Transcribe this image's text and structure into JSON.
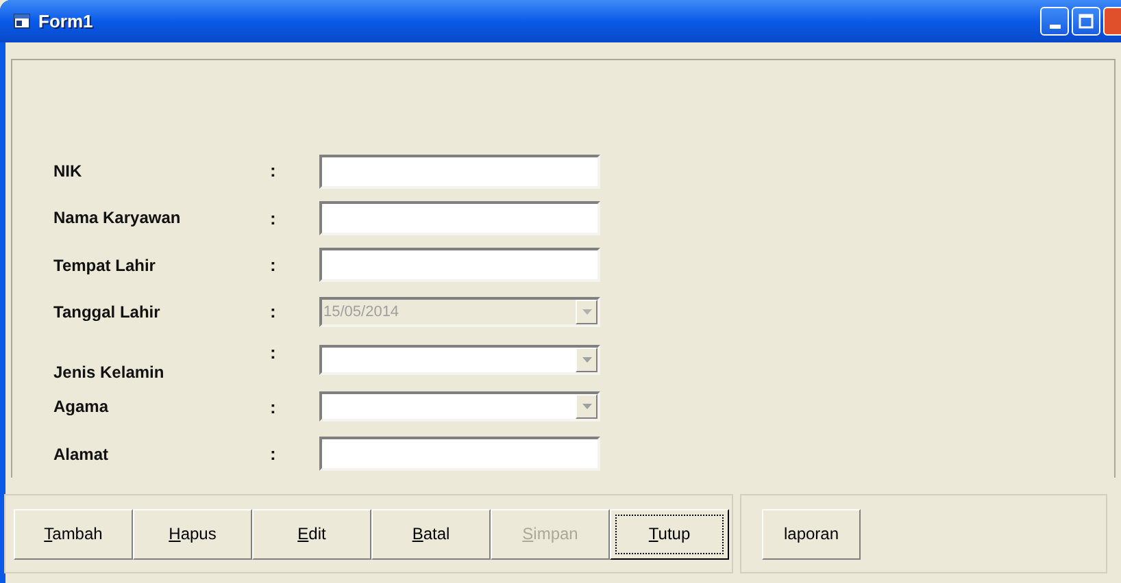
{
  "window": {
    "title": "Form1"
  },
  "fields": [
    {
      "label": "NIK",
      "colon": ":",
      "kind": "text"
    },
    {
      "label": "Nama Karyawan",
      "colon": ":",
      "kind": "text"
    },
    {
      "label": "Tempat Lahir",
      "colon": ":",
      "kind": "text"
    },
    {
      "label": "Tanggal Lahir",
      "colon": ":",
      "kind": "combo",
      "value": "15/05/2014",
      "disabled": true
    },
    {
      "label": "Jenis Kelamin",
      "colon": ":",
      "kind": "combo",
      "disabled": false
    },
    {
      "label": "Agama",
      "colon": ":",
      "kind": "combo",
      "disabled": false
    },
    {
      "label": "Alamat",
      "colon": ":",
      "kind": "text"
    }
  ],
  "buttons": [
    {
      "label": "Tambah",
      "mnemonic": true,
      "disabled": false,
      "focused": false
    },
    {
      "label": "Hapus",
      "mnemonic": true,
      "disabled": false,
      "focused": false
    },
    {
      "label": "Edit",
      "mnemonic": true,
      "disabled": false,
      "focused": false
    },
    {
      "label": "Batal",
      "mnemonic": true,
      "disabled": false,
      "focused": false
    },
    {
      "label": "Simpan",
      "mnemonic": true,
      "disabled": true,
      "focused": false
    },
    {
      "label": "Tutup",
      "mnemonic": true,
      "disabled": false,
      "focused": true
    }
  ],
  "report_button": {
    "label": "laporan",
    "mnemonic": false
  }
}
